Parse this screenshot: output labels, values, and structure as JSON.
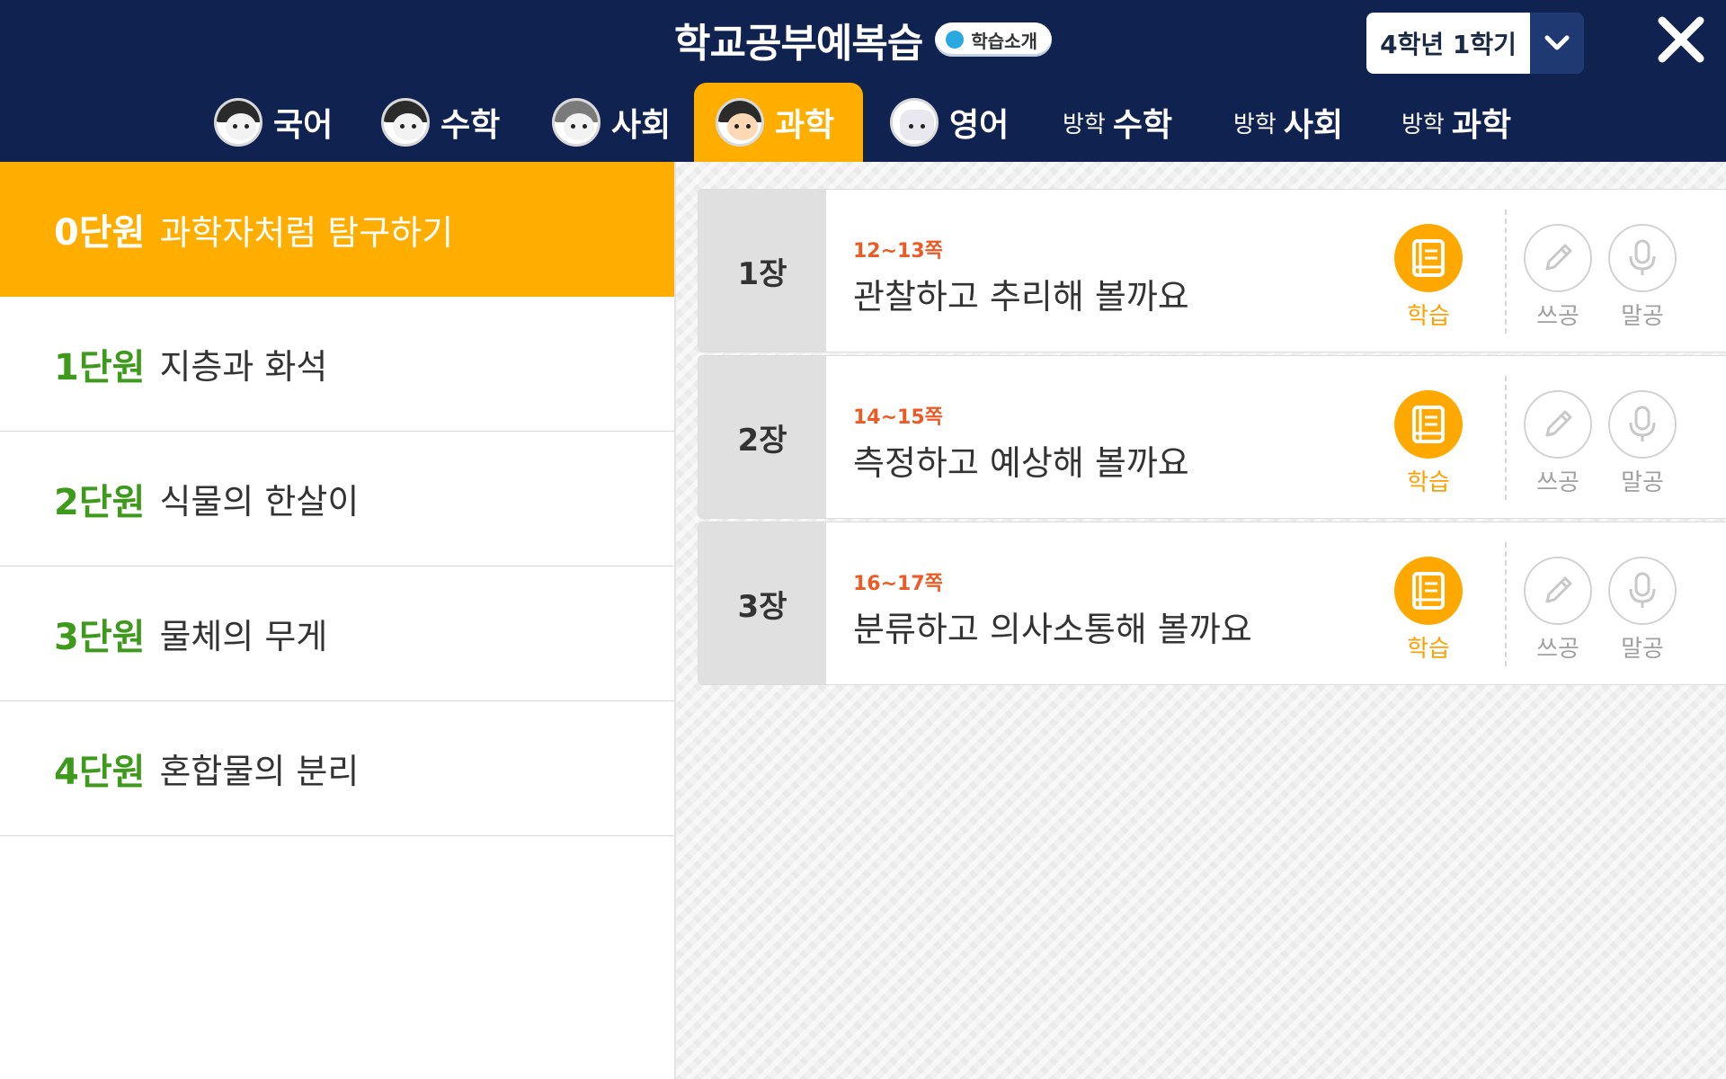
{
  "header": {
    "title": "학교공부예복습",
    "intro_label": "학습소개",
    "grade_label": "4학년 1학기",
    "close_icon": "close-icon",
    "dropdown_icon": "chevron-down-icon"
  },
  "tabs": [
    {
      "label": "국어",
      "prefix": "",
      "icon": "avatar-icon",
      "active": false
    },
    {
      "label": "수학",
      "prefix": "",
      "icon": "avatar-icon",
      "active": false
    },
    {
      "label": "사회",
      "prefix": "",
      "icon": "avatar-icon",
      "active": false
    },
    {
      "label": "과학",
      "prefix": "",
      "icon": "avatar-icon",
      "active": true
    },
    {
      "label": "영어",
      "prefix": "",
      "icon": "robot-avatar-icon",
      "active": false
    },
    {
      "label": "수학",
      "prefix": "방학",
      "icon": "",
      "active": false
    },
    {
      "label": "사회",
      "prefix": "방학",
      "icon": "",
      "active": false
    },
    {
      "label": "과학",
      "prefix": "방학",
      "icon": "",
      "active": false
    }
  ],
  "units": [
    {
      "num": "0단원",
      "name": "과학자처럼 탐구하기",
      "active": true
    },
    {
      "num": "1단원",
      "name": "지층과 화석",
      "active": false
    },
    {
      "num": "2단원",
      "name": "식물의 한살이",
      "active": false
    },
    {
      "num": "3단원",
      "name": "물체의 무게",
      "active": false
    },
    {
      "num": "4단원",
      "name": "혼합물의 분리",
      "active": false
    }
  ],
  "chapters": [
    {
      "num": "1장",
      "pages": "12~13쪽",
      "title": "관찰하고 추리해 볼까요"
    },
    {
      "num": "2장",
      "pages": "14~15쪽",
      "title": "측정하고 예상해 볼까요"
    },
    {
      "num": "3장",
      "pages": "16~17쪽",
      "title": "분류하고 의사소통해 볼까요"
    }
  ],
  "actions": {
    "study": "학습",
    "write": "쓰공",
    "speak": "말공"
  },
  "colors": {
    "header_bg": "#10224f",
    "accent": "#ffae00",
    "unit_num": "#3d9a1a",
    "pages": "#ee5a24"
  }
}
